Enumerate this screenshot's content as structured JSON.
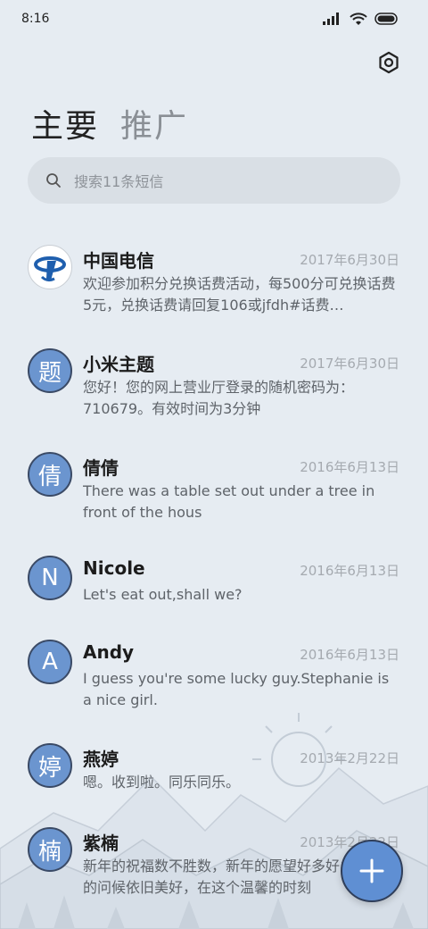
{
  "status_bar": {
    "time": "8:16"
  },
  "tabs": [
    {
      "label": "主要",
      "active": true
    },
    {
      "label": "推广",
      "active": false
    }
  ],
  "search": {
    "placeholder": "搜索11条短信"
  },
  "conversations": [
    {
      "name": "中国电信",
      "date": "2017年6月30日",
      "preview": "欢迎参加积分兑换话费活动，每500分可兑换话费5元，兑换话费请回复106或jfdh#话费…",
      "avatar": "",
      "avatar_type": "logo"
    },
    {
      "name": "小米主题",
      "date": "2017年6月30日",
      "preview": "您好！您的网上营业厅登录的随机密码为：710679。有效时间为3分钟",
      "avatar": "题"
    },
    {
      "name": "倩倩",
      "date": "2016年6月13日",
      "preview": "There was a table set out under a tree in front of the hous",
      "avatar": "倩"
    },
    {
      "name": "Nicole",
      "date": "2016年6月13日",
      "preview": "Let's eat out,shall we?",
      "avatar": "N"
    },
    {
      "name": "Andy",
      "date": "2016年6月13日",
      "preview": "I guess you're some lucky guy.Stephanie is a nice girl.",
      "avatar": "A"
    },
    {
      "name": "燕婷",
      "date": "2013年2月22日",
      "preview": "嗯。收到啦。同乐同乐。",
      "avatar": "婷"
    },
    {
      "name": "紫楠",
      "date": "2013年2月22日",
      "preview": "新年的祝福数不胜数，新年的愿望好多好多，新年的问候依旧美好，在这个温馨的时刻",
      "avatar": "楠"
    }
  ],
  "colors": {
    "accent": "#5f8fd3",
    "avatar_bg": "#6b95cf",
    "background": "#e6ecf2"
  }
}
